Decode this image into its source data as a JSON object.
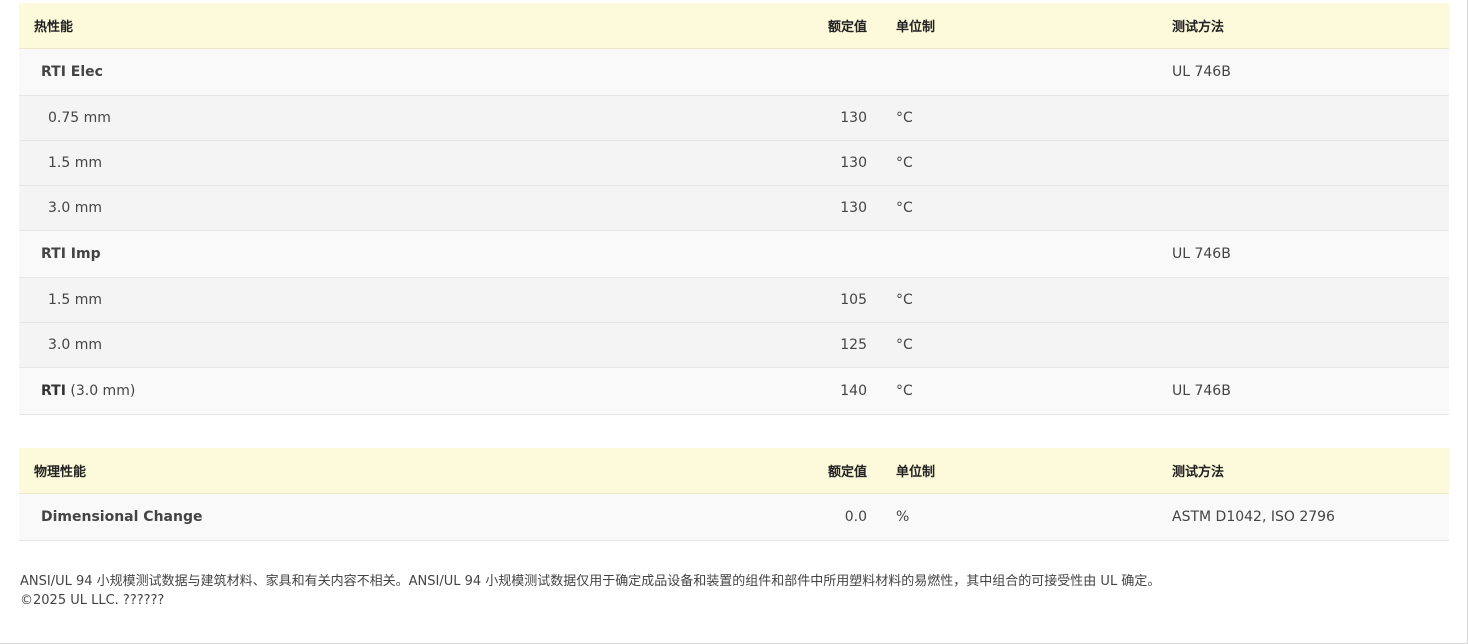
{
  "thermal": {
    "header": {
      "property": "热性能",
      "value": "额定值",
      "unit": "单位制",
      "method": "测试方法"
    },
    "rows": [
      {
        "property": "RTI Elec",
        "value": "",
        "unit": "",
        "method": "UL 746B"
      },
      {
        "property": "0.75 mm",
        "value": "130",
        "unit": "°C",
        "method": ""
      },
      {
        "property": "1.5 mm",
        "value": "130",
        "unit": "°C",
        "method": ""
      },
      {
        "property": "3.0 mm",
        "value": "130",
        "unit": "°C",
        "method": ""
      },
      {
        "property": "RTI Imp",
        "value": "",
        "unit": "",
        "method": "UL 746B"
      },
      {
        "property": "1.5 mm",
        "value": "105",
        "unit": "°C",
        "method": ""
      },
      {
        "property": "3.0 mm",
        "value": "125",
        "unit": "°C",
        "method": ""
      },
      {
        "property": "RTI",
        "property_suffix": "(3.0 mm)",
        "value": "140",
        "unit": "°C",
        "method": "UL 746B"
      }
    ]
  },
  "physical": {
    "header": {
      "property": "物理性能",
      "value": "额定值",
      "unit": "单位制",
      "method": "测试方法"
    },
    "rows": [
      {
        "property": "Dimensional Change",
        "value": "0.0",
        "unit": "%",
        "method": "ASTM D1042, ISO 2796"
      }
    ]
  },
  "footer": {
    "disclaimer": "ANSI/UL 94 小规模测试数据与建筑材料、家具和有关内容不相关。ANSI/UL 94 小规模测试数据仅用于确定成品设备和装置的组件和部件中所用塑料材料的易燃性，其中组合的可接受性由 UL 确定。",
    "copyright": "©2025 UL LLC. ??????"
  }
}
